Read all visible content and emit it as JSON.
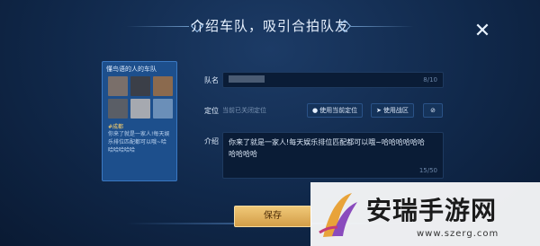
{
  "dialog": {
    "title": "介绍车队，吸引合拍队友",
    "close_label": "✕"
  },
  "team_card": {
    "name": "懂鸟语的人的车队",
    "tag": "#成都",
    "description": "你来了就是一家人!每天娱乐排位匹配都可以哦~哈哈哈哈哈哈"
  },
  "form": {
    "name_label": "队名",
    "name_value": "",
    "name_counter": "8/10",
    "location_label": "定位",
    "location_text": "当前已关闭定位",
    "use_location_label": "使用当前定位",
    "use_zone_label": "使用战区",
    "intro_label": "介绍",
    "intro_value_line1": "你来了就是一家人!每天娱乐排位匹配都可以哦~哈哈哈哈哈哈",
    "intro_value_line2": "哈哈哈哈",
    "intro_counter": "15/50"
  },
  "actions": {
    "save_label": "保存"
  },
  "watermark": {
    "title": "安瑞手游网",
    "url": "www.szerg.com"
  },
  "colors": {
    "accent_gold": "#d39e48",
    "panel_blue": "#1d4f8c"
  }
}
